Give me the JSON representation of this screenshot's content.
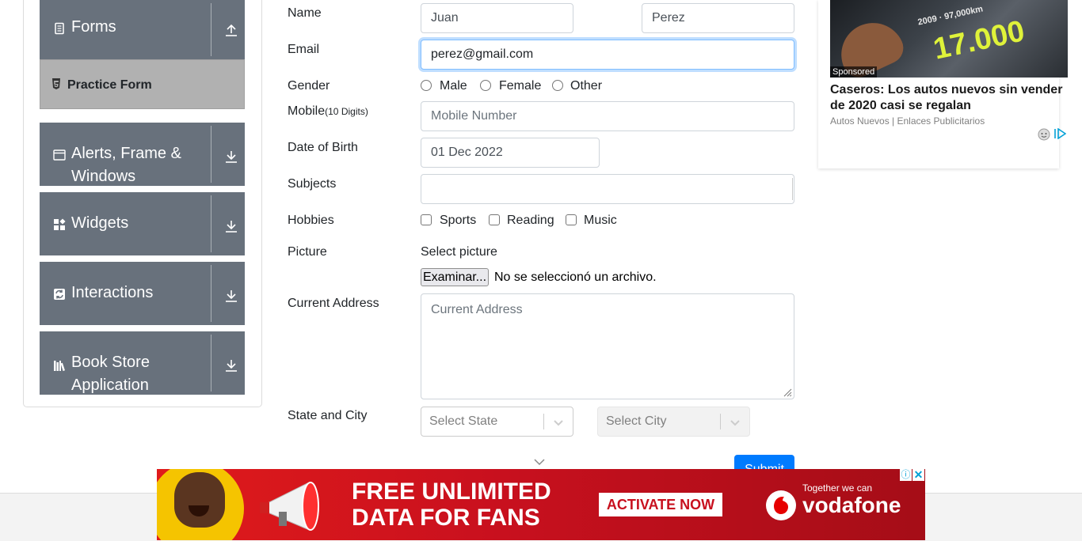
{
  "sidebar": {
    "forms_label": "Forms",
    "practice_form_label": "Practice Form",
    "alerts_label": "Alerts, Frame & Windows",
    "widgets_label": "Widgets",
    "interactions_label": "Interactions",
    "bookstore_label": "Book Store Application"
  },
  "form": {
    "name_label": "Name",
    "first_name": "Juan",
    "last_name": "Perez",
    "email_label": "Email",
    "email": "perez@gmail.com",
    "gender_label": "Gender",
    "gender_options": [
      "Male",
      "Female",
      "Other"
    ],
    "mobile_label": "Mobile",
    "mobile_hint": "(10 Digits)",
    "mobile_placeholder": "Mobile Number",
    "dob_label": "Date of Birth",
    "dob": "01 Dec 2022",
    "subjects_label": "Subjects",
    "hobbies_label": "Hobbies",
    "hobbies_options": [
      "Sports",
      "Reading",
      "Music"
    ],
    "picture_label": "Picture",
    "select_picture": "Select picture",
    "browse_button": "Examinar...",
    "no_file": "No se seleccionó un archivo.",
    "address_label": "Current Address",
    "address_placeholder": "Current Address",
    "state_city_label": "State and City",
    "state_placeholder": "Select State",
    "city_placeholder": "Select City",
    "submit_label": "Submit"
  },
  "ad_right": {
    "sponsored": "Sponsored",
    "headline": "Caseros: Los autos nuevos sin vender de 2020 casi se regalan",
    "source": "Autos Nuevos | Enlaces Publicitarios",
    "price_text": "17.000"
  },
  "ad_bottom": {
    "line1": "FREE UNLIMITED",
    "line2": "DATA FOR FANS",
    "cta": "ACTIVATE NOW",
    "tagline": "Together we can",
    "brand": "vodafone"
  },
  "colors": {
    "sidebar_group": "#68717c",
    "sidebar_active": "#b1b1b1",
    "submit": "#007bff",
    "ad_red": "#c8101e"
  }
}
